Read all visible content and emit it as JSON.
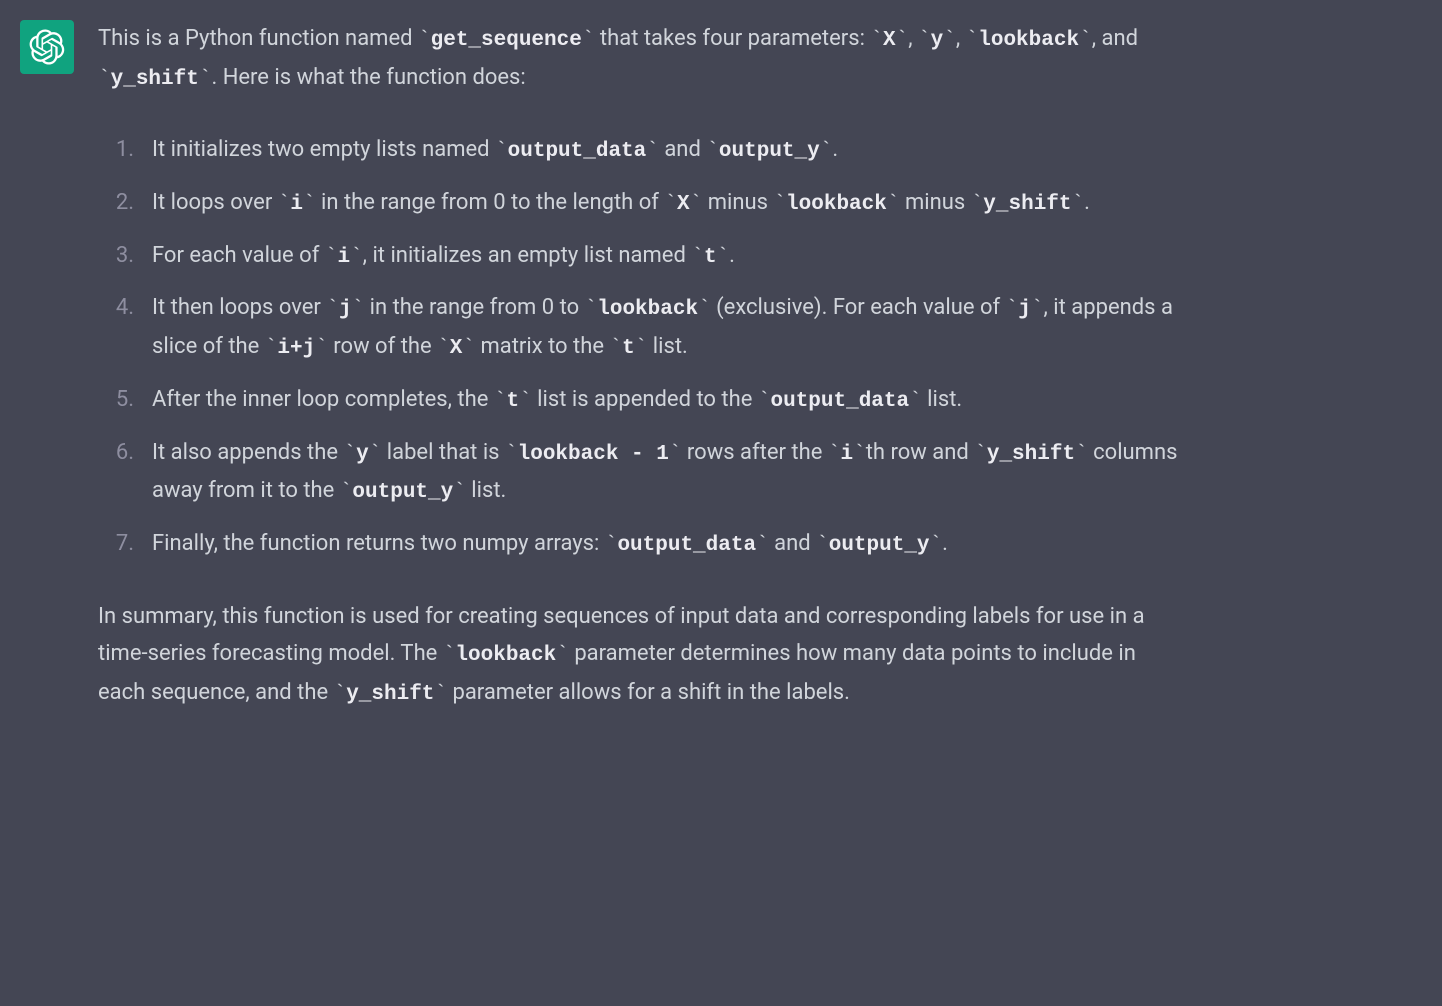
{
  "message": {
    "intro": {
      "part1": "This is a Python function named ",
      "code1": "get_sequence",
      "part2": " that takes four parameters: ",
      "code2": "X",
      "part3": ", ",
      "code3": "y",
      "part4": ", ",
      "code4": "lookback",
      "part5": ", and ",
      "code5": "y_shift",
      "part6": ". Here is what the function does:"
    },
    "steps": [
      {
        "segments": [
          {
            "t": "It initializes two empty lists named "
          },
          {
            "c": "output_data"
          },
          {
            "t": " and "
          },
          {
            "c": "output_y"
          },
          {
            "t": "."
          }
        ]
      },
      {
        "segments": [
          {
            "t": "It loops over "
          },
          {
            "c": "i"
          },
          {
            "t": " in the range from 0 to the length of "
          },
          {
            "c": "X"
          },
          {
            "t": " minus "
          },
          {
            "c": "lookback"
          },
          {
            "t": " minus "
          },
          {
            "c": "y_shift"
          },
          {
            "t": "."
          }
        ]
      },
      {
        "segments": [
          {
            "t": "For each value of "
          },
          {
            "c": "i"
          },
          {
            "t": ", it initializes an empty list named "
          },
          {
            "c": "t"
          },
          {
            "t": "."
          }
        ]
      },
      {
        "segments": [
          {
            "t": "It then loops over "
          },
          {
            "c": "j"
          },
          {
            "t": " in the range from 0 to "
          },
          {
            "c": "lookback"
          },
          {
            "t": " (exclusive). For each value of "
          },
          {
            "c": "j"
          },
          {
            "t": ", it appends a slice of the "
          },
          {
            "c": "i+j"
          },
          {
            "t": " row of the "
          },
          {
            "c": "X"
          },
          {
            "t": " matrix to the "
          },
          {
            "c": "t"
          },
          {
            "t": " list."
          }
        ]
      },
      {
        "segments": [
          {
            "t": "After the inner loop completes, the "
          },
          {
            "c": "t"
          },
          {
            "t": " list is appended to the "
          },
          {
            "c": "output_data"
          },
          {
            "t": " list."
          }
        ]
      },
      {
        "segments": [
          {
            "t": "It also appends the "
          },
          {
            "c": "y"
          },
          {
            "t": " label that is "
          },
          {
            "c": "lookback - 1"
          },
          {
            "t": " rows after the "
          },
          {
            "c": "i"
          },
          {
            "t": "th row and "
          },
          {
            "c": "y_shift"
          },
          {
            "t": " columns away from it to the "
          },
          {
            "c": "output_y"
          },
          {
            "t": " list."
          }
        ]
      },
      {
        "segments": [
          {
            "t": "Finally, the function returns two numpy arrays: "
          },
          {
            "c": "output_data"
          },
          {
            "t": " and "
          },
          {
            "c": "output_y"
          },
          {
            "t": "."
          }
        ]
      }
    ],
    "summary": {
      "segments": [
        {
          "t": "In summary, this function is used for creating sequences of input data and corresponding labels for use in a time-series forecasting model. The "
        },
        {
          "c": "lookback"
        },
        {
          "t": " parameter determines how many data points to include in each sequence, and the "
        },
        {
          "c": "y_shift"
        },
        {
          "t": " parameter allows for a shift in the labels."
        }
      ]
    }
  }
}
